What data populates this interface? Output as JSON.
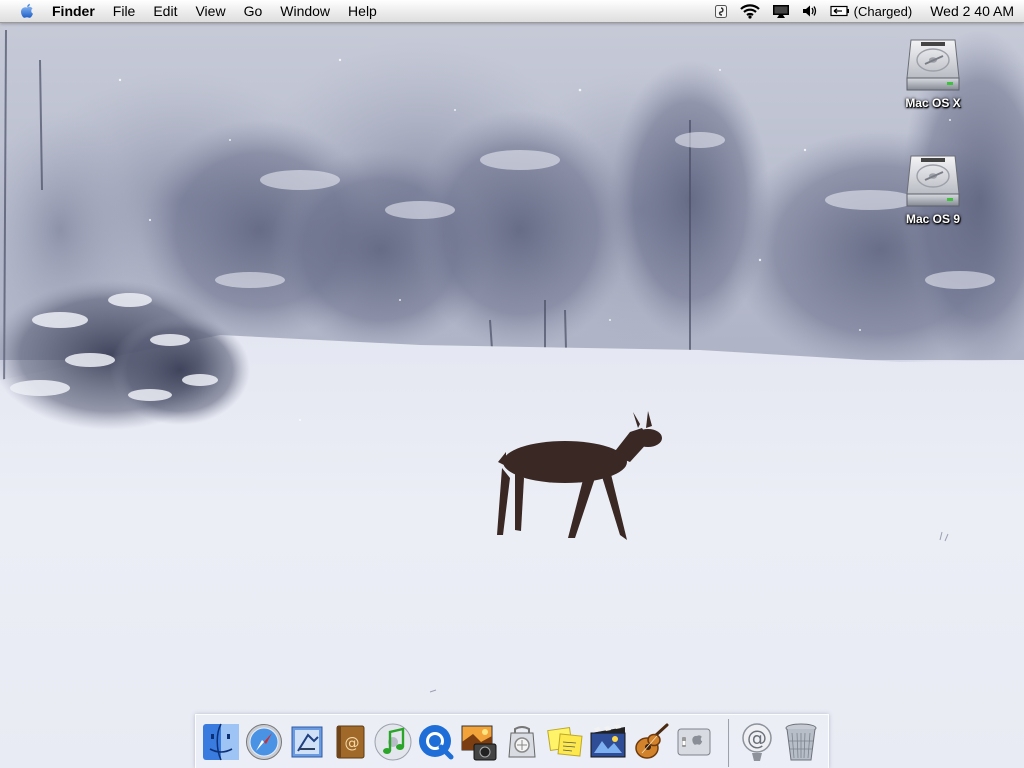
{
  "menubar": {
    "apple_icon": "apple-icon",
    "app_name": "Finder",
    "menus": [
      "File",
      "Edit",
      "View",
      "Go",
      "Window",
      "Help"
    ],
    "extras": {
      "script_icon": "script-menu-icon",
      "wifi_icon": "wifi-icon",
      "display_icon": "display-icon",
      "volume_icon": "volume-icon",
      "battery_icon": "battery-icon",
      "battery_status": "(Charged)",
      "clock": "Wed 2 40 AM"
    }
  },
  "desktop": {
    "wallpaper": "snowy-field-with-deer",
    "icons": [
      {
        "label": "Mac OS X",
        "icon": "hard-drive-icon"
      },
      {
        "label": "Mac OS 9",
        "icon": "hard-drive-icon"
      }
    ]
  },
  "dock": {
    "apps": [
      {
        "name": "Finder",
        "icon": "finder-icon",
        "running": true
      },
      {
        "name": "Safari",
        "icon": "safari-icon",
        "running": false
      },
      {
        "name": "Mail",
        "icon": "mail-icon",
        "running": false
      },
      {
        "name": "Address Book",
        "icon": "address-book-icon",
        "running": false
      },
      {
        "name": "iTunes",
        "icon": "itunes-icon",
        "running": false
      },
      {
        "name": "QuickTime Player",
        "icon": "quicktime-icon",
        "running": false
      },
      {
        "name": "iPhoto",
        "icon": "iphoto-icon",
        "running": false
      },
      {
        "name": "Preview",
        "icon": "preview-icon",
        "running": false
      },
      {
        "name": "Stickies",
        "icon": "stickies-icon",
        "running": false
      },
      {
        "name": "iMovie",
        "icon": "imovie-icon",
        "running": false
      },
      {
        "name": "GarageBand",
        "icon": "garageband-icon",
        "running": false
      },
      {
        "name": "System Preferences",
        "icon": "system-preferences-icon",
        "running": false
      }
    ],
    "others": [
      {
        "name": "Internet",
        "icon": "at-sign-icon"
      },
      {
        "name": "Trash",
        "icon": "trash-icon"
      }
    ],
    "colors": {
      "finder_blue": "#3a7be0",
      "trash_gray": "#b8bec8"
    }
  }
}
